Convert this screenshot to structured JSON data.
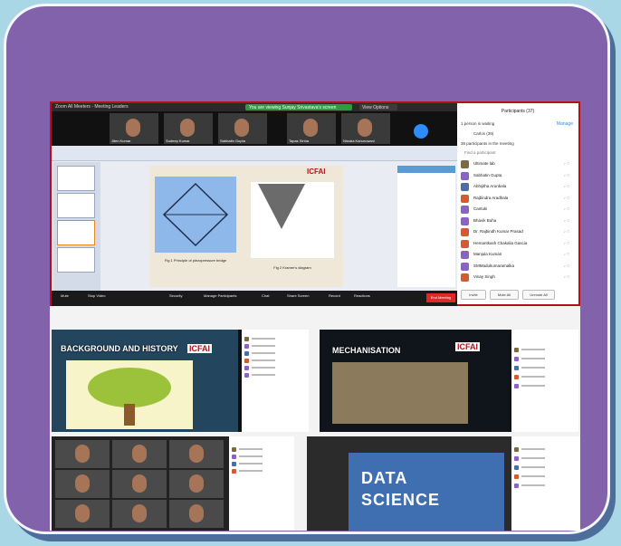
{
  "meeting": {
    "window_title": "Zoom All Meeters - Meeting Leaders",
    "sharing_banner": "You are viewing Sunjay Srivastava's screen",
    "view_options": "View Options",
    "thumbnails": [
      "Jiten Kumar",
      "Sudeep Kumar",
      "Sabhatin Gupta",
      "Tapas Sinha",
      "Nisrala Kanuruwani"
    ],
    "controls": [
      "Mute",
      "Stop Video",
      "Security",
      "Manage Participants",
      "Chat",
      "Share Screen",
      "Record",
      "Reactions"
    ],
    "participant_count": "37",
    "end_meeting": "End Meeting"
  },
  "slide": {
    "logo": "ICFAI",
    "fig1_caption": "Fig 1 Principle of piezopressure bridge",
    "fig2_caption": "Fig 2 Kramer's diagram"
  },
  "participants": {
    "title": "Participants (37)",
    "manage": "Manage",
    "waiting_header": "1 person is waiting",
    "waiting_person": "Carlos (39)",
    "in_meeting_header": "36 participants in the meeting",
    "find": "Find a participant",
    "rows": [
      {
        "name": "Ultimate lab",
        "color": "#7c6a45"
      },
      {
        "name": "Sabhatin Gupta",
        "color": "#8a63c7"
      },
      {
        "name": "Abhijitha Arunbala",
        "color": "#4a6ea8"
      },
      {
        "name": "Rajbindra Aradhala",
        "color": "#d65a30"
      },
      {
        "name": "Cantuki",
        "color": "#8a63c7"
      },
      {
        "name": "Bhavik Buha",
        "color": "#8a63c7"
      },
      {
        "name": "Dr. Rajbindh Kumar Prasad",
        "color": "#d65a30"
      },
      {
        "name": "Hemantkash Chakalia Gascia",
        "color": "#d65a30"
      },
      {
        "name": "Manjula Kumari",
        "color": "#8a63c7"
      },
      {
        "name": "SMMadukumaramalka",
        "color": "#8a63c7"
      },
      {
        "name": "Vinay Singh",
        "color": "#d65a30"
      }
    ],
    "invite": "Invite",
    "mute_all": "Mute All",
    "unmute_all": "Unmute All"
  },
  "panels": {
    "history_title": "BACKGROUND AND HISTORY",
    "history_logo": "ICFAI",
    "mech_title": "MECHANISATION",
    "mech_logo": "ICFAI",
    "ds_word1": "DATA",
    "ds_word2": "SCIENCE"
  },
  "colors": {
    "frame": "#8262aa",
    "zoom_blue": "#2d8cff",
    "end_red": "#e02828"
  }
}
